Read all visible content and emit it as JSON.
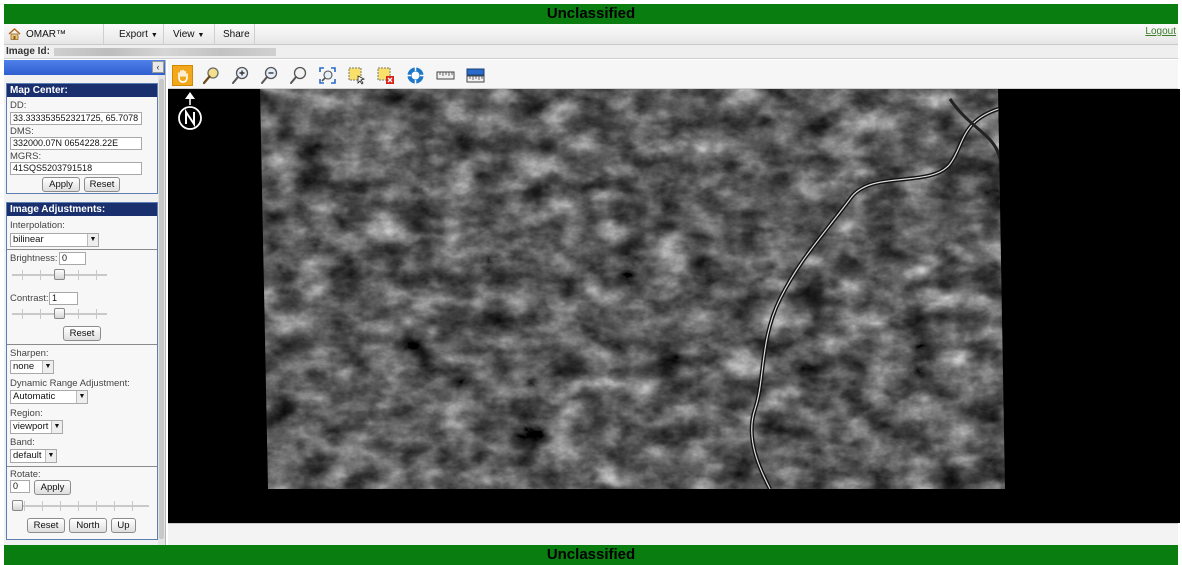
{
  "banner": {
    "top": "Unclassified",
    "bottom": "Unclassified"
  },
  "menu": {
    "home": "OMAR™ Home",
    "export": "Export",
    "view": "View",
    "share": "Share",
    "logout": "Logout"
  },
  "image_id": {
    "label": "Image Id:"
  },
  "map_center": {
    "title": "Map Center:",
    "dd_label": "DD:",
    "dd_value": "33.333353552321725, 65.7078",
    "dms_label": "DMS:",
    "dms_value": "332000.07N 0654228.22E",
    "mgrs_label": "MGRS:",
    "mgrs_value": "41SQS5203791518",
    "apply": "Apply",
    "reset": "Reset"
  },
  "adjust": {
    "title": "Image Adjustments:",
    "interpolation_label": "Interpolation:",
    "interpolation_value": "bilinear",
    "brightness_label": "Brightness:",
    "brightness_value": "0",
    "contrast_label": "Contrast:",
    "contrast_value": "1",
    "reset": "Reset",
    "sharpen_label": "Sharpen:",
    "sharpen_value": "none",
    "dra_label": "Dynamic Range Adjustment:",
    "dra_value": "Automatic",
    "region_label": "Region:",
    "region_value": "viewport",
    "band_label": "Band:",
    "band_value": "default",
    "rotate_label": "Rotate:",
    "rotate_value": "0",
    "apply": "Apply",
    "reset2": "Reset",
    "north": "North",
    "up": "Up"
  },
  "toolbar": {
    "tools": [
      "pan-icon",
      "zoom-box-icon",
      "zoom-in-icon",
      "zoom-out-icon",
      "zoom-magnify-icon",
      "full-extent-icon",
      "select-box-icon",
      "clear-selection-icon",
      "center-icon",
      "measure-icon",
      "scale-icon"
    ]
  },
  "colors": {
    "banner": "#0a7d10",
    "section_title": "#1a2f6e",
    "panel_header": "#3a68d8",
    "active_tool": "#f2a81a"
  }
}
